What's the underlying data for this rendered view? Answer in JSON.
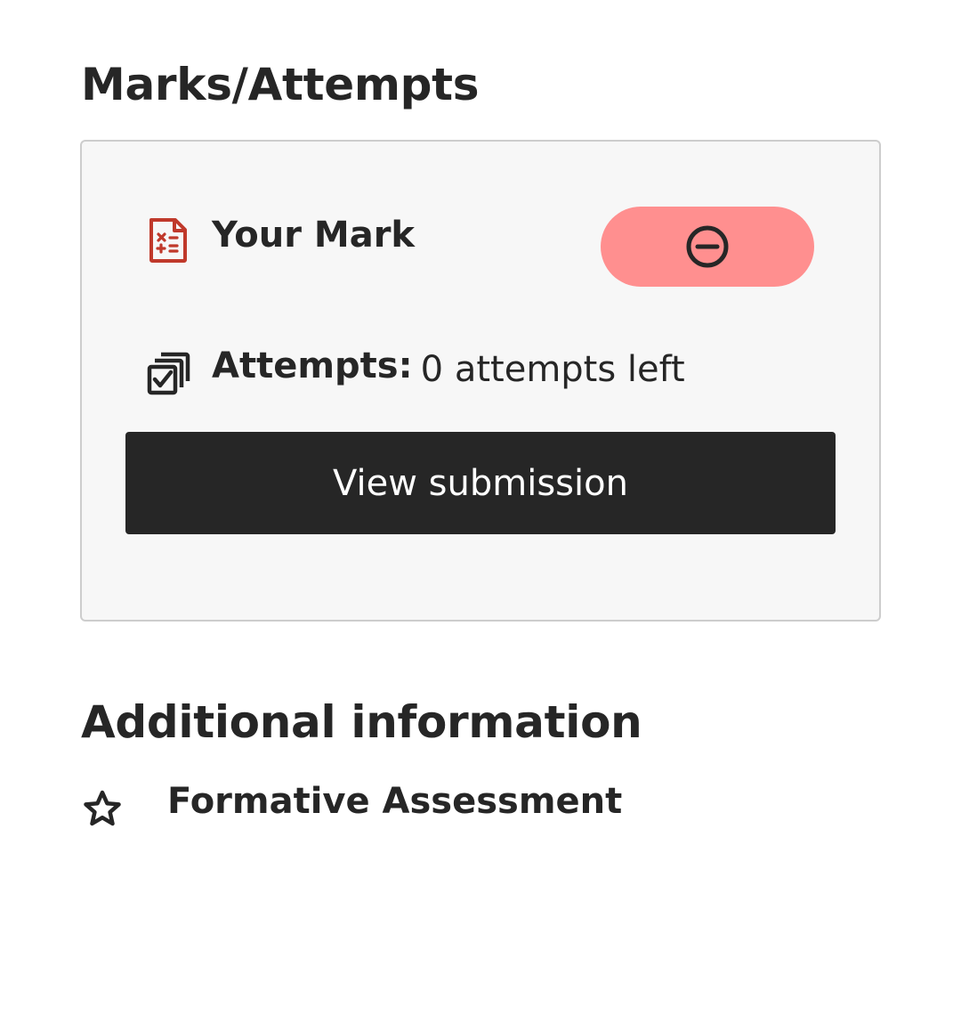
{
  "marks_section": {
    "title": "Marks/Attempts",
    "your_mark_label": "Your Mark",
    "mark_status_icon": "minus-circle-icon",
    "attempts_label": "Attempts:",
    "attempts_value": "0 attempts left",
    "view_submission_label": "View submission"
  },
  "additional_section": {
    "title": "Additional information",
    "items": [
      {
        "icon": "star-outline-icon",
        "label": "Formative Assessment"
      }
    ]
  },
  "colors": {
    "mark_icon": "#c0392b",
    "mark_pill": "#ff8f8f",
    "button_bg": "#262626",
    "card_bg": "#f7f7f7",
    "card_border": "#cdcdcd",
    "text": "#262626"
  }
}
